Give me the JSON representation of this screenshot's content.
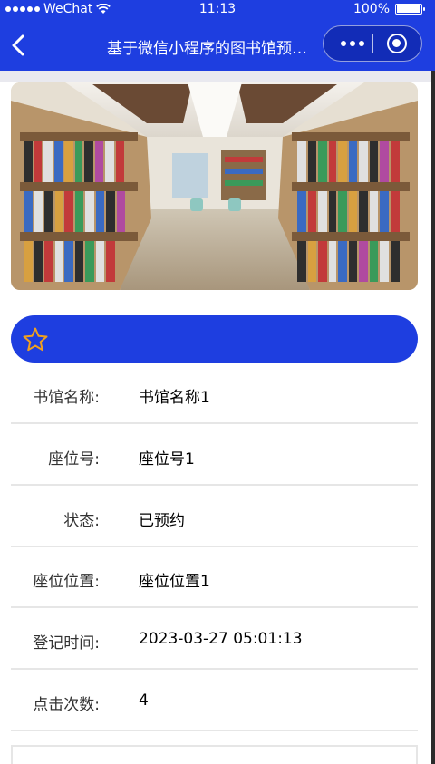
{
  "status_bar": {
    "carrier": "WeChat",
    "time": "11:13",
    "battery": "100%"
  },
  "nav": {
    "title": "基于微信小程序的图书馆预约..."
  },
  "banner": {
    "icon": "library-photo"
  },
  "favorite": {
    "icon": "star-icon"
  },
  "details": [
    {
      "label": "书馆名称:",
      "value": "书馆名称1"
    },
    {
      "label": "座位号:",
      "value": "座位号1"
    },
    {
      "label": "状态:",
      "value": "已预约"
    },
    {
      "label": "座位位置:",
      "value": "座位位置1"
    },
    {
      "label": "登记时间:",
      "value": "2023-03-27 05:01:13"
    },
    {
      "label": "点击次数:",
      "value": "4"
    }
  ],
  "colors": {
    "primary": "#1e3ee0",
    "star": "#f0a020",
    "divider": "#e6e6e6"
  }
}
